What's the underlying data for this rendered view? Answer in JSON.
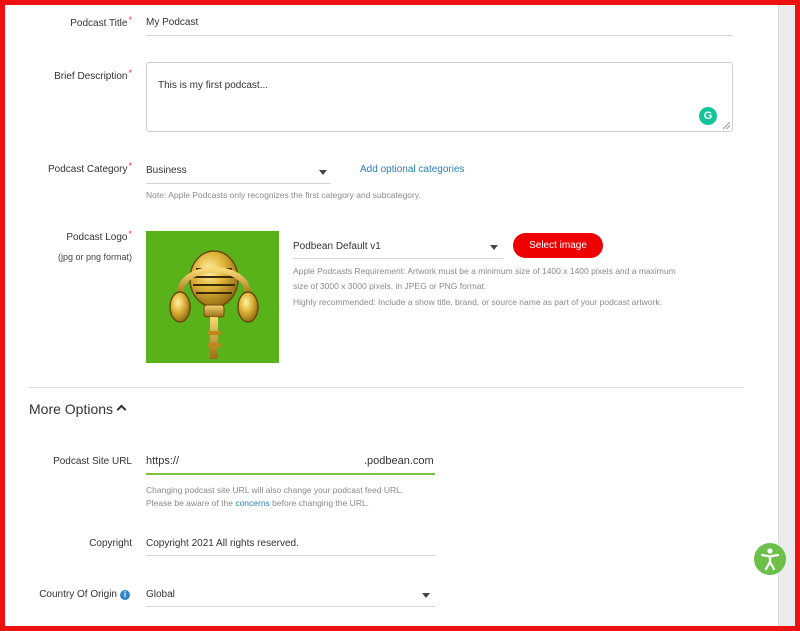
{
  "form": {
    "podcast_title": {
      "label": "Podcast Title",
      "required_mark": "*",
      "value": "My Podcast"
    },
    "brief_description": {
      "label": "Brief Description",
      "required_mark": "*",
      "value": "This is my first podcast..."
    },
    "podcast_category": {
      "label": "Podcast Category",
      "required_mark": "*",
      "value": "Business",
      "add_link": "Add optional categories",
      "note": "Note: Apple Podcasts only recognizes the first category and subcategory."
    },
    "podcast_logo": {
      "label": "Podcast Logo",
      "required_mark": "*",
      "sub_label": "(jpg or png format)",
      "default_option": "Podbean Default v1",
      "select_button": "Select image",
      "requirement_line1": "Apple Podcasts Requirement: Artwork must be a minimum size of 1400 x 1400 pixels and a maximum",
      "requirement_line2": "size of 3000 x 3000 pixels, in JPEG or PNG format.",
      "recommendation": "Highly recommended: Include a show title, brand, or source name as part of your podcast artwork."
    },
    "more_options": {
      "label": "More Options",
      "site_url": {
        "label": "Podcast Site URL",
        "prefix": "https://",
        "suffix": ".podbean.com",
        "help_line1": "Changing podcast site URL will also change your podcast feed URL.",
        "help_line2_before": "Please be aware of the ",
        "help_link": "concerns",
        "help_line2_after": " before changing the URL."
      },
      "copyright": {
        "label": "Copyright",
        "value": "Copyright 2021 All rights reserved."
      },
      "country": {
        "label": "Country Of Origin",
        "value": "Global"
      }
    }
  },
  "colors": {
    "frame": "#ee1111",
    "accent_green": "#7cc242",
    "link": "#2a7fb3",
    "button_red": "#ee0000",
    "required": "#e53935",
    "grammarly": "#15c39a",
    "accessibility": "#6cc04a"
  },
  "icons": {
    "grammarly": "grammarly-icon",
    "dropdown": "chevron-down-icon",
    "collapse": "chevron-up-icon",
    "info": "info-icon",
    "accessibility": "accessibility-icon"
  }
}
